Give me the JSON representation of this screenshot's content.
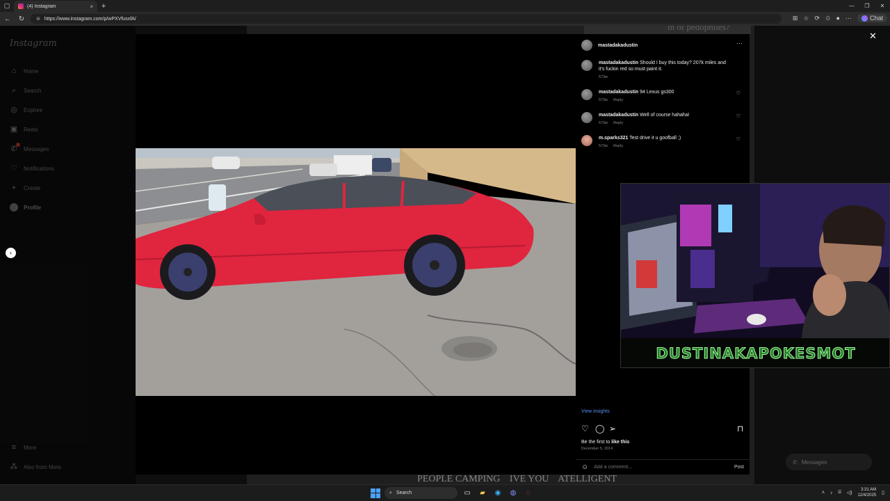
{
  "browser": {
    "tab_title": "(4) Instagram",
    "tab_close": "×",
    "new_tab": "+",
    "url": "https://www.instagram.com/p/wPXVfusxfA/",
    "chat_label": "Chat"
  },
  "sidebar": {
    "logo": "Instagram",
    "items": [
      {
        "label": "Home",
        "icon": "home-icon"
      },
      {
        "label": "Search",
        "icon": "search-icon"
      },
      {
        "label": "Explore",
        "icon": "compass-icon"
      },
      {
        "label": "Reels",
        "icon": "reels-icon"
      },
      {
        "label": "Messages",
        "icon": "messenger-icon"
      },
      {
        "label": "Notifications",
        "icon": "heart-icon"
      },
      {
        "label": "Create",
        "icon": "plus-icon"
      },
      {
        "label": "Profile",
        "icon": "avatar"
      }
    ],
    "more": "More",
    "also_from_meta": "Also from Meta"
  },
  "background": {
    "top_text": "in of pedophiles?",
    "bottom_text_1": "PEOPLE CAMPING",
    "bottom_text_2": "IVE YOU",
    "bottom_text_3": "ATELLIGENT"
  },
  "post": {
    "author": "mastadakadustin",
    "comments": [
      {
        "user": "mastadakadustin",
        "text": "Should I buy this today? 207k miles and it's fuckin red so must paint it.",
        "age": "573w",
        "reply": ""
      },
      {
        "user": "mastadakadustin",
        "text": "94 Lexus gs300",
        "age": "573w",
        "reply": "Reply"
      },
      {
        "user": "mastadakadustin",
        "text": "Well of course hahaha!",
        "age": "573w",
        "reply": "Reply"
      },
      {
        "user": "m.sparks321",
        "text": "Test drive it u goofball ;)",
        "age": "573w",
        "reply": "Reply"
      }
    ],
    "view_insights": "View insights",
    "likes_prefix": "Be the first to ",
    "likes_bold": "like this",
    "date": "December 5, 2014",
    "add_comment_placeholder": "Add a comment...",
    "post_button": "Post"
  },
  "stream": {
    "banner": "DUSTINAKAPOKESMOT"
  },
  "messages_pill": "Messages",
  "taskbar": {
    "search": "Search",
    "time": "3:31 AM",
    "date": "12/4/2025"
  }
}
